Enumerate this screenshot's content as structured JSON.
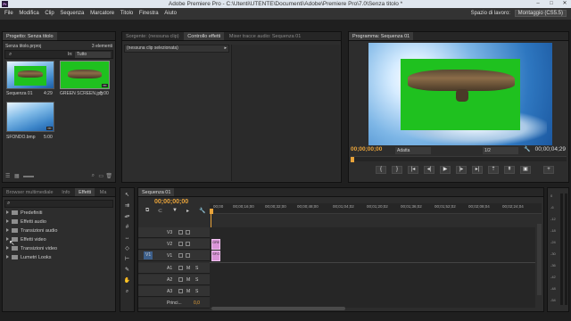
{
  "window": {
    "title": "Adobe Premiere Pro - C:\\Utenti\\UTENTE\\Documenti\\Adobe\\Premiere Pro\\7.0\\Senza titolo *",
    "logo": "Pr"
  },
  "menu": [
    "File",
    "Modifica",
    "Clip",
    "Sequenza",
    "Marcatore",
    "Titolo",
    "Finestra",
    "Aiuto"
  ],
  "workspace": {
    "label": "Spazio di lavoro:",
    "value": "Montaggio (CS5.5)"
  },
  "project": {
    "tab": "Progetto: Senza titolo",
    "filename": "Senza titolo.prproj",
    "count": "3 elementi",
    "in_label": "In:",
    "in_value": "Tutto",
    "items": [
      {
        "name": "Sequenza 01",
        "dur": "4:29"
      },
      {
        "name": "GREEN SCREEN.jpg",
        "dur": "5:00"
      },
      {
        "name": "SFONDO.bmp",
        "dur": "5:00"
      }
    ]
  },
  "source": {
    "tabs": [
      "Sorgente: (nessuna clip)",
      "Controllo effetti",
      "Mixer tracce audio: Sequenza 01"
    ],
    "empty": "(nessuna clip selezionata)"
  },
  "program": {
    "tab": "Programma: Sequenza 01",
    "tc_in": "00;00;00;00",
    "fit": "Adatta",
    "res": "1/2",
    "tc_out": "00;00;04;29"
  },
  "effects": {
    "tabs": [
      "Browser multimediale",
      "Info",
      "Effetti",
      "Ma"
    ],
    "items": [
      "Predefiniti",
      "Effetti audio",
      "Transizioni audio",
      "Effetti video",
      "Transizioni video",
      "Lumetri Looks"
    ]
  },
  "timeline": {
    "tab": "Sequenza 01",
    "tc": "00;00;00;00",
    "ruler": [
      "00;00",
      "00;00;16;00",
      "00;00;32;00",
      "00;00;48;00",
      "00;01;04;02",
      "00;01;20;02",
      "00;01;36;02",
      "00;01;52;02",
      "00;02;08;04",
      "00;02;24;04"
    ],
    "video_tracks": [
      "V3",
      "V2",
      "V1"
    ],
    "audio_tracks": [
      "A1",
      "A2",
      "A3"
    ],
    "v1_src": "V1",
    "m_label": "M",
    "s_label": "S",
    "master": "Princi...",
    "master_val": "0,0",
    "clip_v2": "GREEN",
    "clip_v1": "SFONDO"
  },
  "meter": [
    "0",
    "-6",
    "-12",
    "-18",
    "-24",
    "-30",
    "-36",
    "-42",
    "-48",
    "-54"
  ],
  "colors": {
    "accent": "#e8a33a",
    "green": "#1fc11f",
    "clip": "#d994d8",
    "timecode": "#e8a33a"
  }
}
